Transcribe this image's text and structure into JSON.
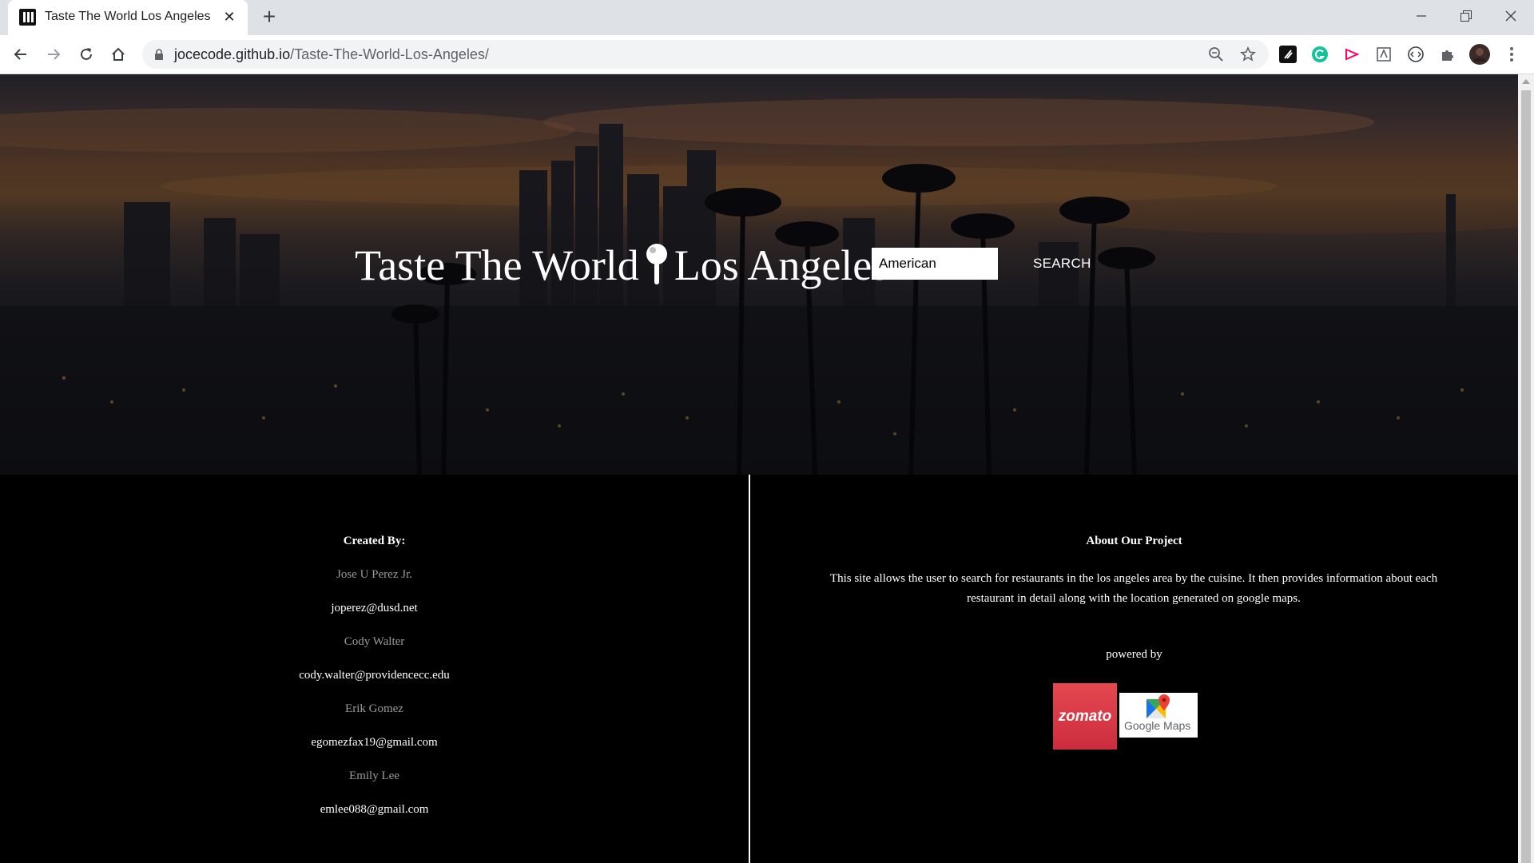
{
  "browser": {
    "tab_title": "Taste The World Los Angeles",
    "tab_close": "✕",
    "new_tab": "+",
    "url_host": "jocecode.github.io",
    "url_path": "/Taste-The-World-Los-Angeles/"
  },
  "hero": {
    "title_part1": "Taste The World",
    "title_part2": "Los Angeles",
    "search_value": "American",
    "search_button": "SEARCH"
  },
  "credits": {
    "heading": "Created By:",
    "people": [
      {
        "name": "Jose U Perez Jr.",
        "email": "joperez@dusd.net"
      },
      {
        "name": "Cody Walter",
        "email": "cody.walter@providencecc.edu"
      },
      {
        "name": "Erik Gomez",
        "email": "egomezfax19@gmail.com"
      },
      {
        "name": "Emily Lee",
        "email": "emlee088@gmail.com"
      }
    ]
  },
  "about": {
    "heading": "About Our Project",
    "text": "This site allows the user to search for restaurants in the los angeles area by the cuisine. It then provides information about each restaurant in detail along with the location generated on google maps.",
    "powered_by": "powered by",
    "logos": {
      "zomato": "zomato",
      "google_maps": "Google Maps"
    }
  },
  "colors": {
    "page_bg": "#000000",
    "chrome_bg": "#dee1e6",
    "zomato_red": "#cb2d3e"
  }
}
